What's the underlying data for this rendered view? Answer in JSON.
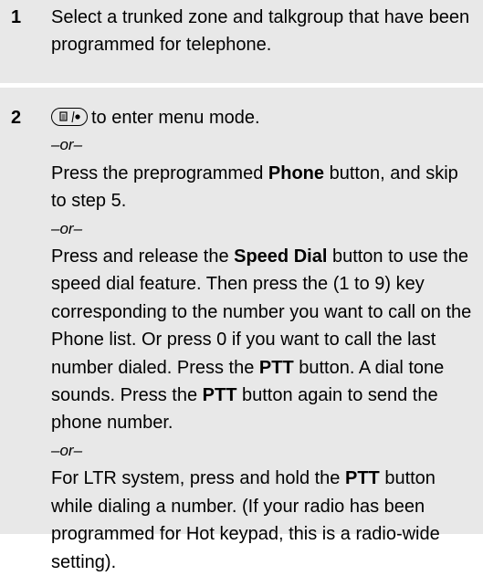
{
  "step1": {
    "number": "1",
    "text": "Select a trunked zone and talkgroup that have been programmed for telephone."
  },
  "step2": {
    "number": "2",
    "line1_after_icon": "to enter menu mode.",
    "or1": "–or–",
    "opt1_pre": "Press the preprogrammed ",
    "opt1_bold": "Phone",
    "opt1_post": " button, and skip to step 5.",
    "or2": "–or–",
    "opt2_a": "Press and release the ",
    "opt2_b_bold": "Speed Dial",
    "opt2_c": " button to use the speed dial feature. Then press the (1 to 9) key corresponding to the number you want to call on the Phone list. Or press 0 if you want to call the last number dialed. Press the ",
    "opt2_d_bold": "PTT",
    "opt2_e": " button. A dial tone sounds. Press the ",
    "opt2_f_bold": "PTT",
    "opt2_g": " button again to send the phone number.",
    "or3": "–or–",
    "opt3_a": "For LTR system, press and hold the ",
    "opt3_b_bold": "PTT",
    "opt3_c": " button while dialing a number. (If your radio has been programmed for Hot keypad, this is a radio-wide setting)."
  },
  "icons": {
    "menu_key": "menu-select-key-icon"
  }
}
